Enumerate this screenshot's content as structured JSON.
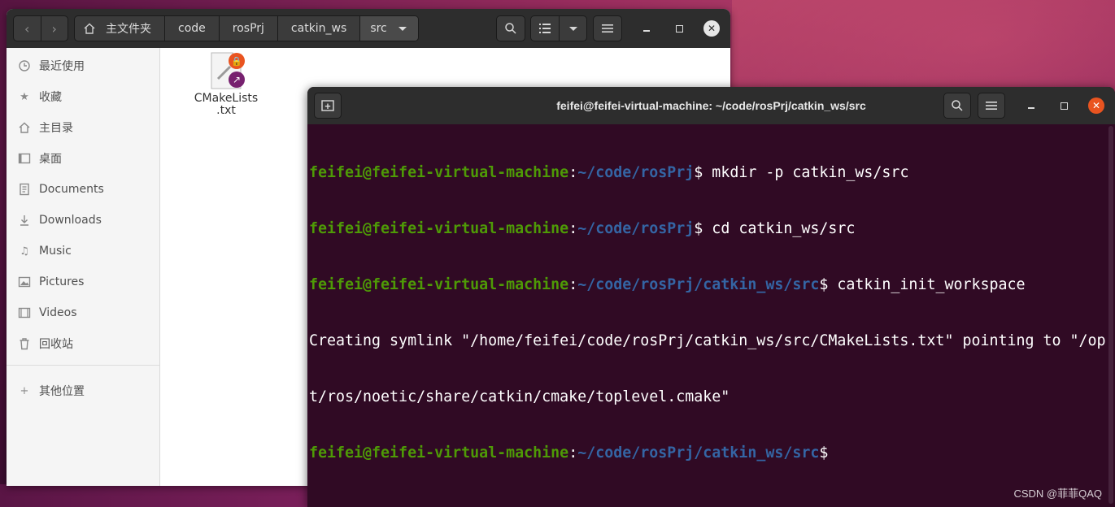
{
  "file_manager": {
    "breadcrumbs": [
      "主文件夹",
      "code",
      "rosPrj",
      "catkin_ws",
      "src"
    ],
    "sidebar": [
      {
        "label": "最近使用",
        "icon": "clock-icon"
      },
      {
        "label": "收藏",
        "icon": "star-icon"
      },
      {
        "label": "主目录",
        "icon": "home-icon"
      },
      {
        "label": "桌面",
        "icon": "desktop-icon"
      },
      {
        "label": "Documents",
        "icon": "document-icon"
      },
      {
        "label": "Downloads",
        "icon": "download-icon"
      },
      {
        "label": "Music",
        "icon": "music-icon"
      },
      {
        "label": "Pictures",
        "icon": "picture-icon"
      },
      {
        "label": "Videos",
        "icon": "video-icon"
      },
      {
        "label": "回收站",
        "icon": "trash-icon"
      },
      {
        "label": "其他位置",
        "icon": "plus-icon"
      }
    ],
    "file": {
      "name_line1": "CMakeLists",
      "name_line2": ".txt"
    }
  },
  "terminal": {
    "title": "feifei@feifei-virtual-machine: ~/code/rosPrj/catkin_ws/src",
    "lines": [
      {
        "user": "feifei@feifei-virtual-machine",
        "sep": ":",
        "path": "~/code/rosPrj",
        "cmd": "$ mkdir -p catkin_ws/src"
      },
      {
        "user": "feifei@feifei-virtual-machine",
        "sep": ":",
        "path": "~/code/rosPrj",
        "cmd": "$ cd catkin_ws/src"
      },
      {
        "user": "feifei@feifei-virtual-machine",
        "sep": ":",
        "path": "~/code/rosPrj/catkin_ws/src",
        "cmd": "$ catkin_init_workspace"
      },
      {
        "output": "Creating symlink \"/home/feifei/code/rosPrj/catkin_ws/src/CMakeLists.txt\" pointing to \"/op"
      },
      {
        "output": "t/ros/noetic/share/catkin/cmake/toplevel.cmake\""
      },
      {
        "user": "feifei@feifei-virtual-machine",
        "sep": ":",
        "path": "~/code/rosPrj/catkin_ws/src",
        "cmd": "$"
      }
    ]
  },
  "watermark": "CSDN @菲菲QAQ",
  "colors": {
    "prompt_user": "#4e9a06",
    "prompt_path": "#3465a4",
    "terminal_bg": "#300a24",
    "close_accent": "#e95420"
  }
}
